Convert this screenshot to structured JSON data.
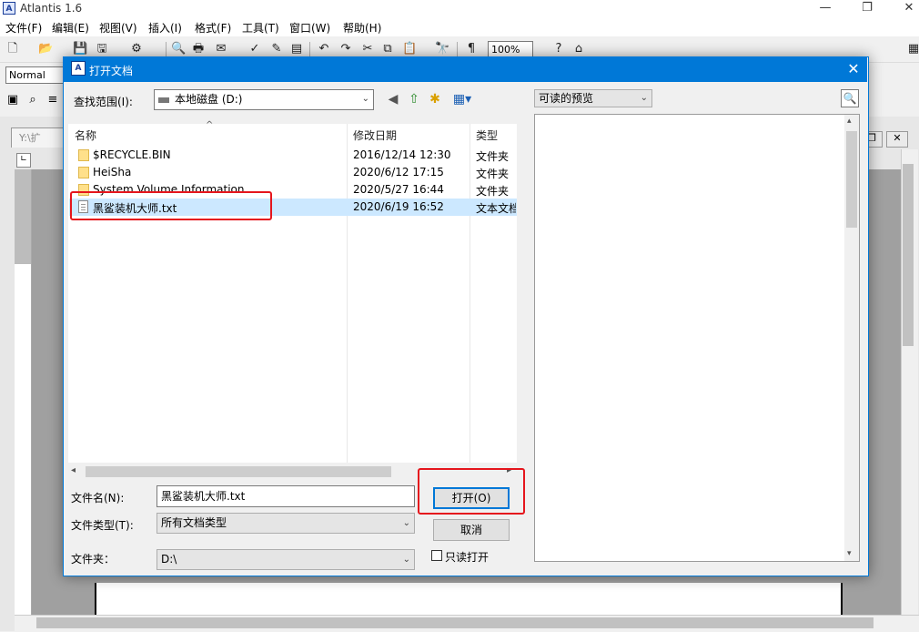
{
  "app": {
    "title": "Atlantis 1.6",
    "minimize": "—",
    "maximize": "❐",
    "close": "✕"
  },
  "menu": [
    "文件(F)",
    "编辑(E)",
    "视图(V)",
    "插入(I)",
    "格式(F)",
    "工具(T)",
    "窗口(W)",
    "帮助(H)"
  ],
  "toolbar": {
    "zoom": "100%",
    "style": "Normal"
  },
  "document": {
    "tab_label": "Y:\\扩"
  },
  "dialog": {
    "title": "打开文档",
    "close": "✕",
    "look_in_label": "查找范围(I):",
    "look_in_value": "本地磁盘 (D:)",
    "preview_label": "可读的预览",
    "columns": {
      "name": "名称",
      "date": "修改日期",
      "type": "类型"
    },
    "files": [
      {
        "name": "$RECYCLE.BIN",
        "date": "2016/12/14 12:30",
        "type": "文件夹",
        "kind": "folder"
      },
      {
        "name": "HeiSha",
        "date": "2020/6/12 17:15",
        "type": "文件夹",
        "kind": "folder"
      },
      {
        "name": "System Volume Information",
        "date": "2020/5/27 16:44",
        "type": "文件夹",
        "kind": "folder"
      },
      {
        "name": "黑鲨装机大师.txt",
        "date": "2020/6/19 16:52",
        "type": "文本文档",
        "kind": "file"
      }
    ],
    "filename_label": "文件名(N):",
    "filename_value": "黑鲨装机大师.txt",
    "filetype_label": "文件类型(T):",
    "filetype_value": "所有文档类型",
    "folder_label": "文件夹：",
    "folder_value": "D:\\",
    "open_button": "打开(O)",
    "cancel_button": "取消",
    "readonly_label": "只读打开"
  },
  "colors": {
    "accent": "#0078d7",
    "highlight": "#e5161d",
    "selection": "#cce8ff"
  }
}
